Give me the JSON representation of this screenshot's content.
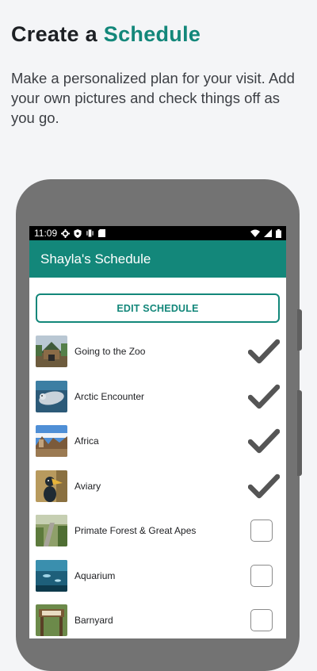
{
  "promo": {
    "headline_prefix": "Create a",
    "headline_accent": "Schedule",
    "subtitle": "Make a personalized plan for your visit. Add your own pictures and check things off as you go."
  },
  "status_bar": {
    "time": "11:09"
  },
  "app": {
    "title": "Shayla's Schedule",
    "edit_button": "EDIT SCHEDULE"
  },
  "schedule": {
    "items": [
      {
        "label": "Going to the Zoo",
        "checked": true
      },
      {
        "label": "Arctic Encounter",
        "checked": true
      },
      {
        "label": "Africa",
        "checked": true
      },
      {
        "label": "Aviary",
        "checked": true
      },
      {
        "label": "Primate Forest & Great Apes",
        "checked": false
      },
      {
        "label": "Aquarium",
        "checked": false
      },
      {
        "label": "Barnyard",
        "checked": false
      }
    ]
  },
  "colors": {
    "accent": "#13877a",
    "checkmark": "#555555"
  }
}
